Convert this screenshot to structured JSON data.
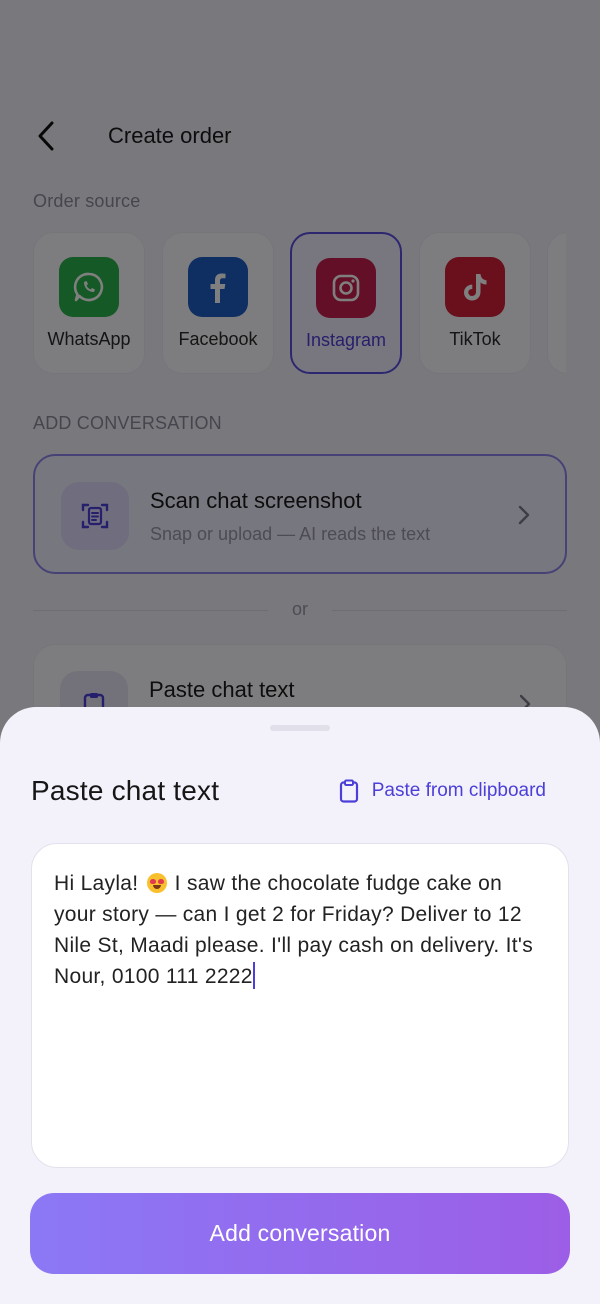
{
  "header": {
    "title": "Create order"
  },
  "order_source": {
    "label": "Order source",
    "selected": "Instagram",
    "items": [
      {
        "label": "WhatsApp",
        "icon": "whatsapp-icon",
        "color": "#2bb24c"
      },
      {
        "label": "Facebook",
        "icon": "facebook-icon",
        "color": "#1e5fc4"
      },
      {
        "label": "Instagram",
        "icon": "instagram-icon",
        "color": "#c71f4f"
      },
      {
        "label": "TikTok",
        "icon": "tiktok-icon",
        "color": "#d4203a"
      }
    ]
  },
  "add_conversation": {
    "label": "ADD CONVERSATION",
    "scan": {
      "title": "Scan chat screenshot",
      "subtitle": "Snap or upload — AI reads the text"
    },
    "divider": "or",
    "paste": {
      "title": "Paste chat text"
    }
  },
  "sheet": {
    "title": "Paste chat text",
    "clipboard_label": "Paste from clipboard",
    "text_before_emoji": "Hi Layla! ",
    "emoji": "heart-eyes-emoji",
    "text_after_emoji": " I saw the chocolate fudge cake on your story — can I get 2 for Friday? Deliver to 12 Nile St, Maadi please. I'll pay cash on delivery. It's Nour, 0100 111 2222",
    "button_label": "Add conversation"
  },
  "colors": {
    "accent": "#4c3fd8",
    "button_gradient_start": "#8b78f5",
    "button_gradient_end": "#9c5ee6"
  }
}
